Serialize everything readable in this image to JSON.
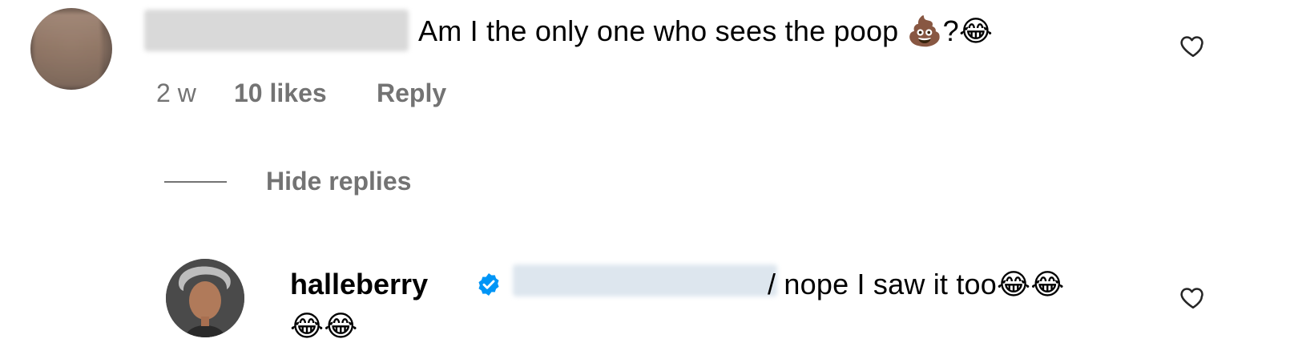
{
  "comment": {
    "text": "Am I the only one who sees the poop 💩?😂",
    "time": "2 w",
    "likes": "10 likes",
    "reply_label": "Reply"
  },
  "thread": {
    "toggle_label": "Hide replies"
  },
  "reply": {
    "username": "halleberry",
    "text": "/ nope I saw it too😂😂",
    "text_cont": "😂😂"
  },
  "icons": {
    "heart": "heart-outline-icon",
    "verified": "verified-badge-icon",
    "verified_color": "#0095f6"
  }
}
